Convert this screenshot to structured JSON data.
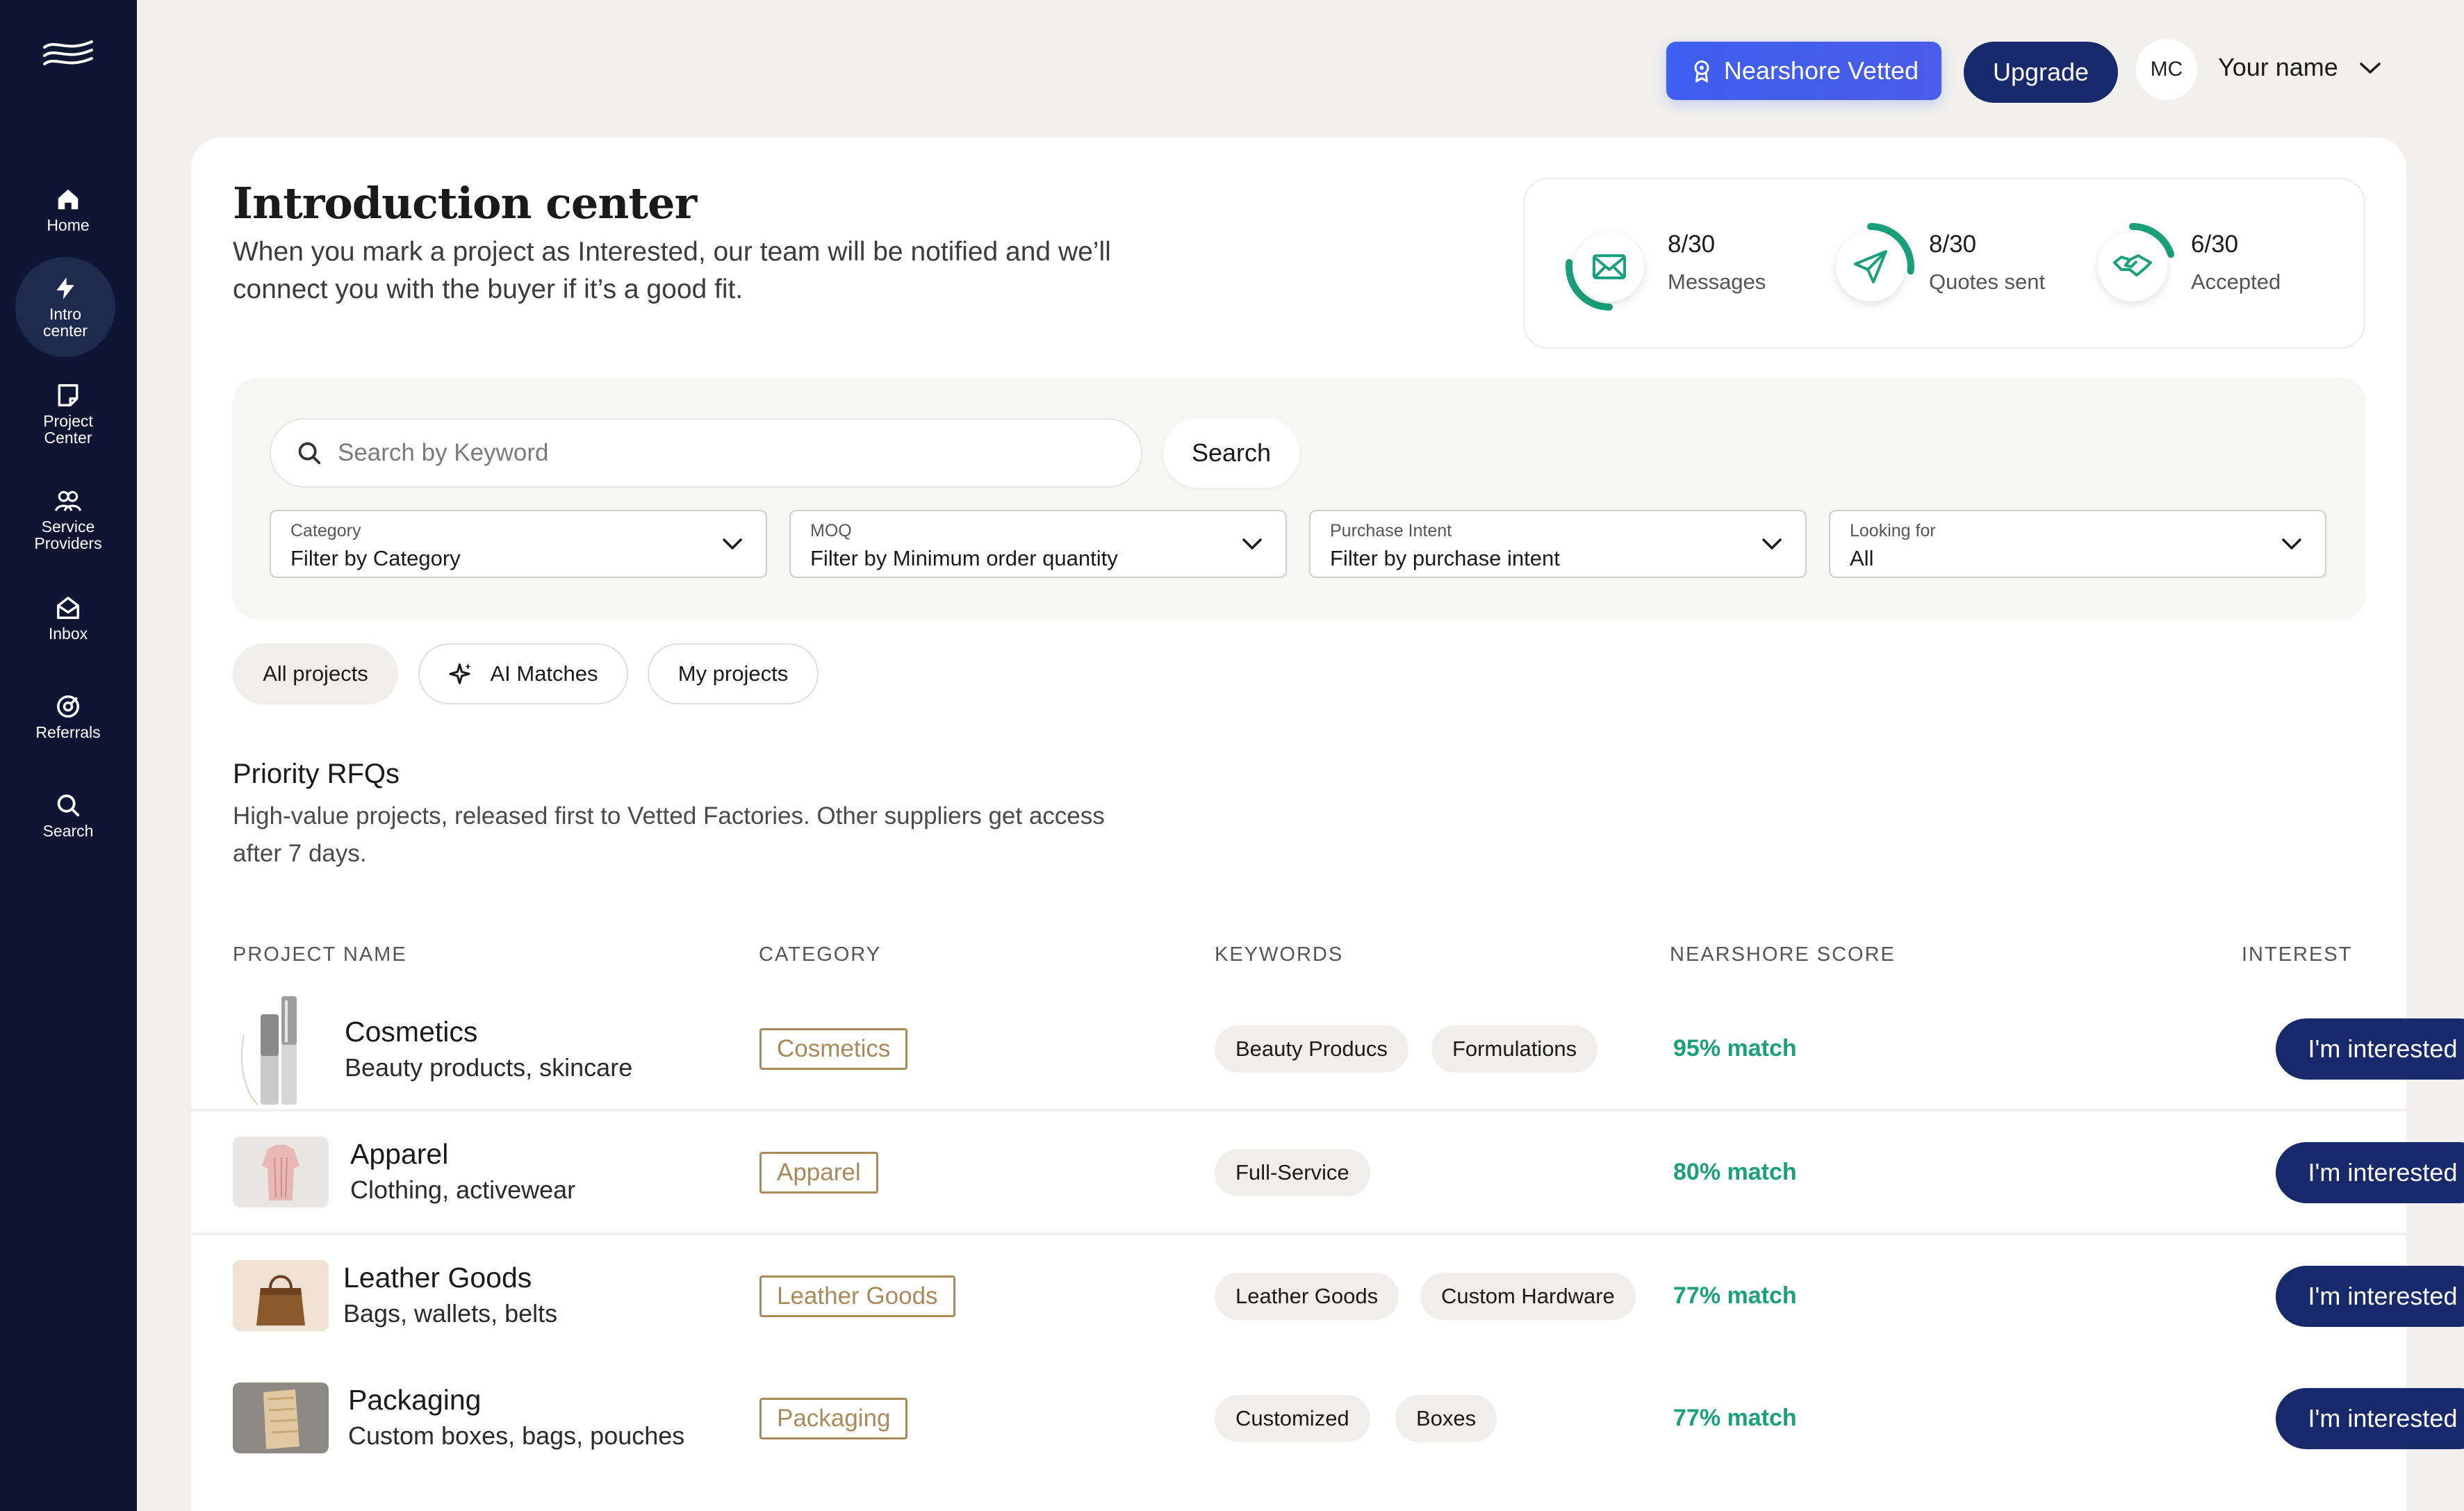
{
  "sidebar": {
    "items": [
      {
        "label": "Home",
        "icon": "home-icon"
      },
      {
        "label": "Intro\ncenter",
        "icon": "bolt-icon"
      },
      {
        "label": "Project\nCenter",
        "icon": "note-icon"
      },
      {
        "label": "Service\nProviders",
        "icon": "users-icon"
      },
      {
        "label": "Inbox",
        "icon": "inbox-icon"
      },
      {
        "label": "Referrals",
        "icon": "referrals-icon"
      },
      {
        "label": "Search",
        "icon": "search-icon"
      }
    ]
  },
  "header": {
    "vetted_badge": "Nearshore Vetted",
    "upgrade_label": "Upgrade",
    "avatar_initials": "MC",
    "user_name": "Your name"
  },
  "intro": {
    "title": "Introduction center",
    "description": "When you mark a project as Interested, our team will be notified and we’ll connect you with the buyer if it’s a good fit."
  },
  "stats": [
    {
      "value": "8/30",
      "label": "Messages",
      "progress": 0.267,
      "icon": "mail-icon"
    },
    {
      "value": "8/30",
      "label": "Quotes sent",
      "progress": 0.267,
      "icon": "send-icon"
    },
    {
      "value": "6/30",
      "label": "Accepted",
      "progress": 0.2,
      "icon": "handshake-icon"
    }
  ],
  "search": {
    "placeholder": "Search by Keyword",
    "button_label": "Search"
  },
  "filters": [
    {
      "label": "Category",
      "value": "Filter by Category"
    },
    {
      "label": "MOQ",
      "value": "Filter by Minimum order quantity"
    },
    {
      "label": "Purchase Intent",
      "value": "Filter by purchase intent"
    },
    {
      "label": "Looking for",
      "value": "All"
    }
  ],
  "tabs": {
    "all_projects": "All projects",
    "ai_matches": "AI Matches",
    "my_projects": "My projects"
  },
  "priority": {
    "title": "Priority RFQs",
    "description": "High-value projects, released first to Vetted Factories. Other suppliers get access after 7 days."
  },
  "table": {
    "headers": {
      "project": "PROJECT NAME",
      "category": "CATEGORY",
      "keywords": "KEYWORDS",
      "score": "NEARSHORE SCORE",
      "interest": "INTEREST"
    },
    "rows": [
      {
        "name": "Cosmetics",
        "subtitle": "Beauty products, skincare",
        "category": "Cosmetics",
        "keywords": [
          "Beauty Producs",
          "Formulations"
        ],
        "score": "95% match",
        "action": "I'm interested"
      },
      {
        "name": "Apparel",
        "subtitle": "Clothing, activewear",
        "category": "Apparel",
        "keywords": [
          "Full-Service"
        ],
        "score": "80% match",
        "action": "I'm interested"
      },
      {
        "name": "Leather Goods",
        "subtitle": "Bags, wallets, belts",
        "category": "Leather Goods",
        "keywords": [
          "Leather Goods",
          "Custom Hardware"
        ],
        "score": "77% match",
        "action": "I'm interested"
      },
      {
        "name": "Packaging",
        "subtitle": "Custom boxes, bags, pouches",
        "category": "Packaging",
        "keywords": [
          "Customized",
          "Boxes"
        ],
        "score": "77% match",
        "action": "I'm interested"
      }
    ]
  },
  "colors": {
    "sidebar": "#0f1633",
    "navy": "#182a6b",
    "accent_blue": "#3e5ff0",
    "score_green": "#1aa07a",
    "tag_gold": "#a98a5a"
  }
}
